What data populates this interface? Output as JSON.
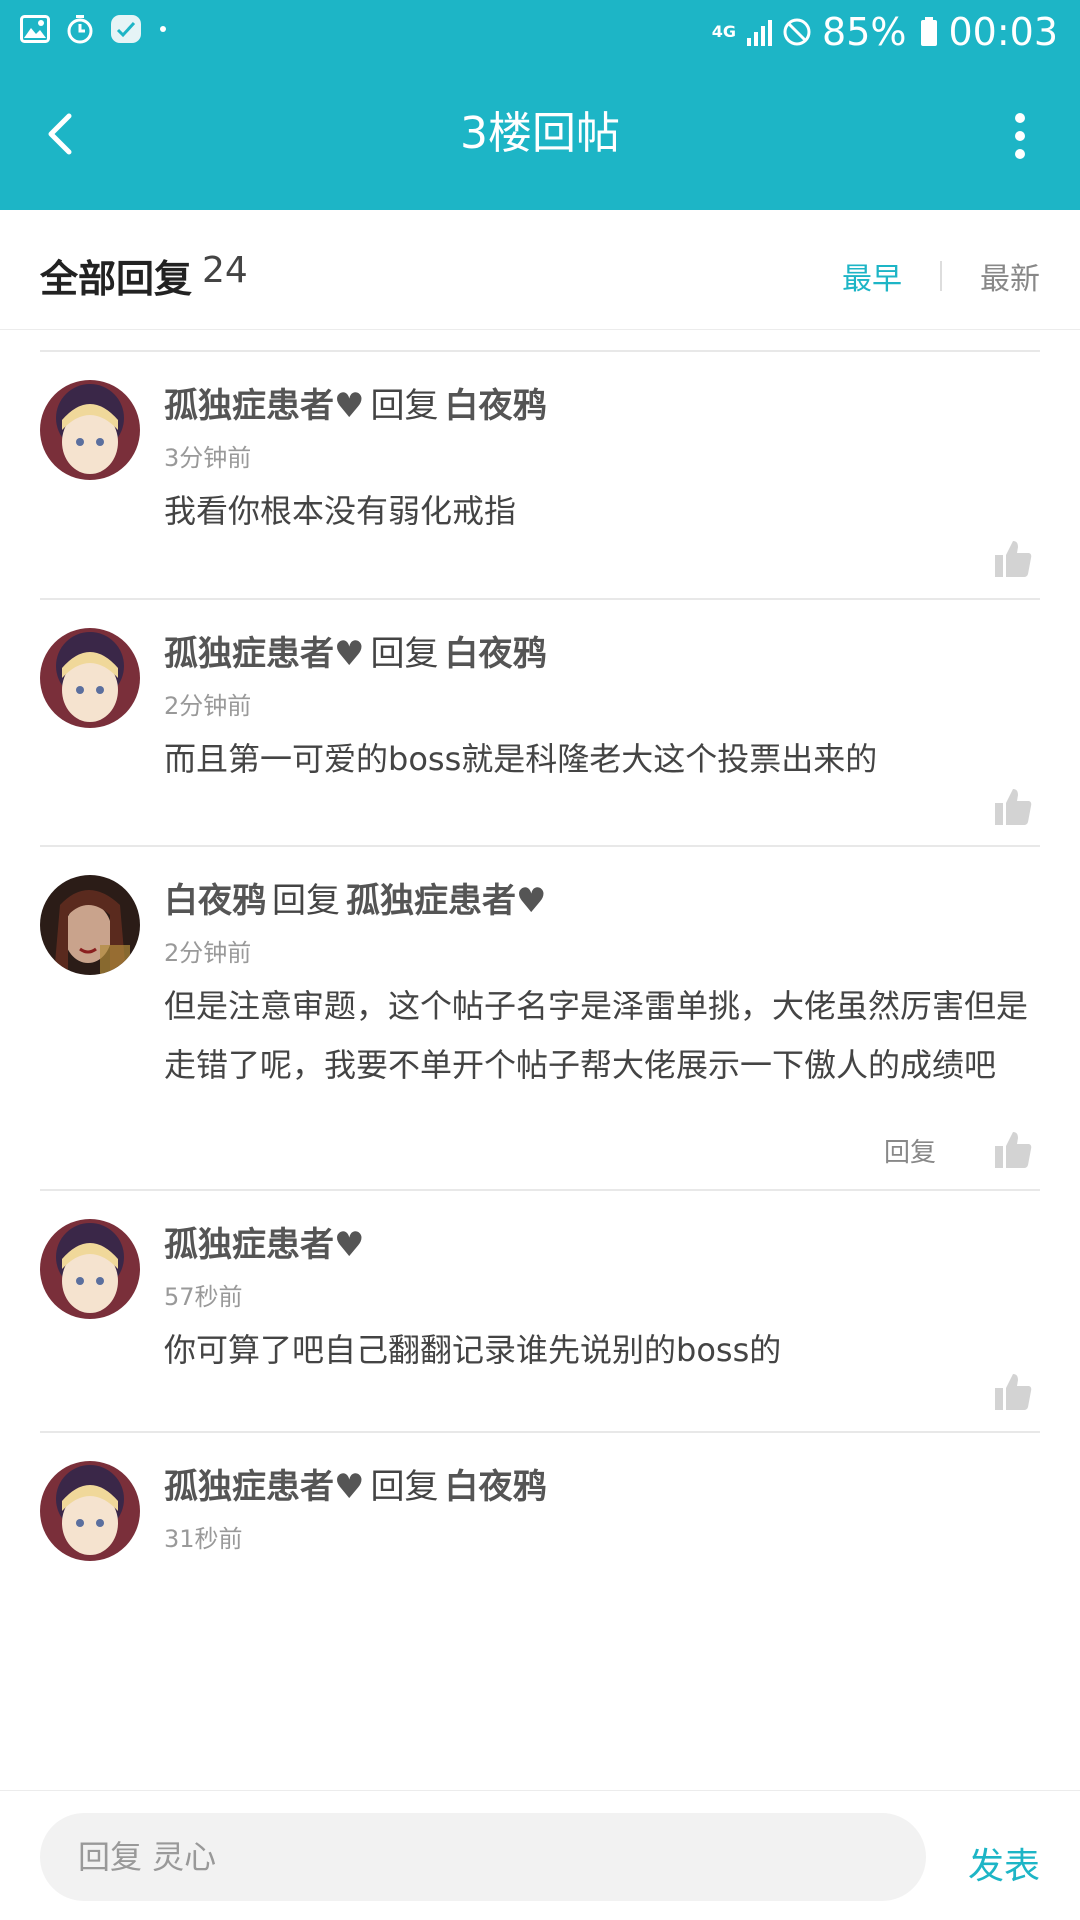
{
  "status_bar": {
    "left_icons": [
      "gallery-icon",
      "stopwatch-icon",
      "app-notification-icon",
      "dot-icon"
    ],
    "network": "4G",
    "battery_percent": "85%",
    "time": "00:03"
  },
  "app_bar": {
    "title": "3楼回帖",
    "back_icon": "chevron-left-icon",
    "more_icon": "more-vertical-icon"
  },
  "list_header": {
    "title": "全部回复",
    "count": "24",
    "sort_options": [
      "最早",
      "最新"
    ],
    "active_sort": "最早"
  },
  "reply_word": "回复",
  "replies": [
    {
      "author": "孤独症患者♥",
      "reply_to": "白夜鸦",
      "time": "3分钟前",
      "content": "我看你根本没有弱化戒指",
      "show_reply_link": false
    },
    {
      "author": "孤独症患者♥",
      "reply_to": "白夜鸦",
      "time": "2分钟前",
      "content": "而且第一可爱的boss就是科隆老大这个投票出来的",
      "show_reply_link": false
    },
    {
      "author": "白夜鸦",
      "reply_to": "孤独症患者♥",
      "time": "2分钟前",
      "content": "但是注意审题，这个帖子名字是泽雷单挑，大佬虽然厉害但是走错了呢，我要不单开个帖子帮大佬展示一下傲人的成绩吧",
      "show_reply_link": true,
      "reply_link_label": "回复"
    },
    {
      "author": "孤独症患者♥",
      "reply_to": "",
      "time": "57秒前",
      "content": "你可算了吧自己翻翻记录谁先说别的boss的",
      "show_reply_link": false
    },
    {
      "author": "孤独症患者♥",
      "reply_to": "白夜鸦",
      "time": "31秒前",
      "content": "",
      "show_reply_link": false
    }
  ],
  "compose": {
    "placeholder": "回复 灵心",
    "send_label": "发表"
  },
  "colors": {
    "accent": "#1db5c6",
    "text_primary": "#444444",
    "text_muted": "#999999"
  }
}
